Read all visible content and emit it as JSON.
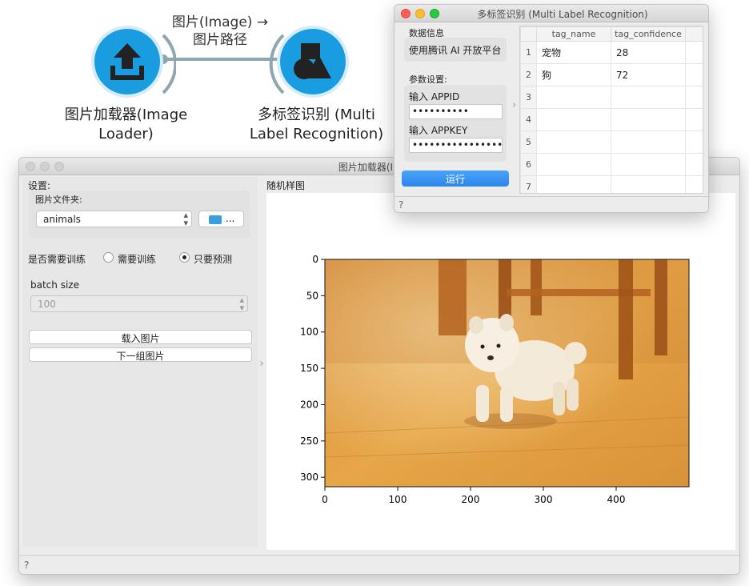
{
  "workflow": {
    "link_label_line1": "图片(Image) →",
    "link_label_line2": "图片路径",
    "node_loader_label_line1": "图片加载器(Image",
    "node_loader_label_line2": "Loader)",
    "node_recog_label_line1": "多标签识别 (Multi",
    "node_recog_label_line2": "Label Recognition)",
    "icons": [
      "upload-icon",
      "shapes-icon"
    ],
    "colors": {
      "node": "#1a9de0",
      "link": "#8fa6ae"
    }
  },
  "loader_window": {
    "title": "图片加载器(Image",
    "settings_label": "设置:",
    "folder_label": "图片文件夹:",
    "folder_value": "animals",
    "browse_label": "...",
    "train_label": "是否需要训练",
    "radio_train": "需要训练",
    "radio_predict": "只要预测",
    "radio_selected": "只要预测",
    "batch_label": "batch size",
    "batch_value": "100",
    "load_button": "载入图片",
    "next_button": "下一组图片",
    "sample_title": "随机样图",
    "help": "?"
  },
  "recog_window": {
    "title": "多标签识别 (Multi Label Recognition)",
    "data_info_label": "数据信息",
    "platform_button": "使用腾讯 AI 开放平台",
    "params_label": "参数设置:",
    "appid_label": "输入 APPID",
    "appid_value": "••••••••••",
    "appkey_label": "输入 APPKEY",
    "appkey_value": "••••••••••••••••",
    "run_button": "运行",
    "help": "?",
    "table": {
      "headers": [
        "tag_name",
        "tag_confidence"
      ],
      "rows": [
        {
          "n": "1",
          "tag_name": "宠物",
          "tag_confidence": "28"
        },
        {
          "n": "2",
          "tag_name": "狗",
          "tag_confidence": "72"
        },
        {
          "n": "3",
          "tag_name": "",
          "tag_confidence": ""
        },
        {
          "n": "4",
          "tag_name": "",
          "tag_confidence": ""
        },
        {
          "n": "5",
          "tag_name": "",
          "tag_confidence": ""
        },
        {
          "n": "6",
          "tag_name": "",
          "tag_confidence": ""
        },
        {
          "n": "7",
          "tag_name": "",
          "tag_confidence": ""
        }
      ]
    },
    "run_color": "#2f8cf0"
  },
  "chart_data": {
    "type": "image",
    "x_ticks": [
      0,
      100,
      200,
      300,
      400
    ],
    "y_ticks": [
      0,
      50,
      100,
      150,
      200,
      250,
      300
    ],
    "xlim": [
      0,
      500
    ],
    "ylim": [
      0,
      313
    ],
    "image_content": "puppy on wooden floor"
  }
}
